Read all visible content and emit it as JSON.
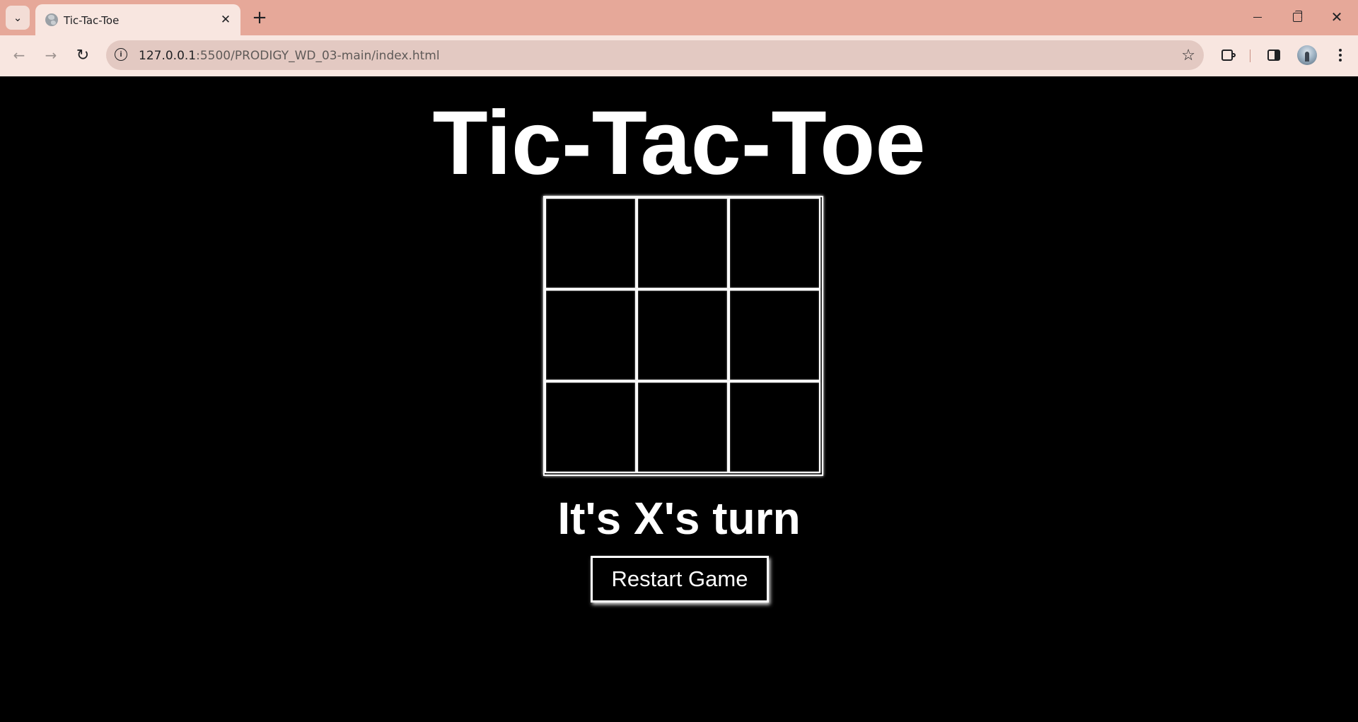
{
  "browser": {
    "tab": {
      "title": "Tic-Tac-Toe",
      "favicon": "globe-icon",
      "close_icon": "close-icon"
    },
    "new_tab_glyph": "+",
    "address": {
      "host": "127.0.0.1",
      "path": ":5500/PRODIGY_WD_03-main/index.html",
      "site_info_icon": "info-icon",
      "bookmark_icon": "star-icon"
    },
    "toolbar_icons": [
      "back-icon",
      "forward-icon",
      "reload-icon",
      "extensions-icon",
      "side-panel-icon",
      "avatar",
      "menu-icon"
    ],
    "window_controls": [
      "minimize-icon",
      "maximize-icon",
      "close-icon"
    ],
    "colors": {
      "frame": "#e6a899",
      "toolbar": "#f8e6e0",
      "omnibox": "#e3c9c2"
    }
  },
  "game": {
    "title": "Tic-Tac-Toe",
    "cells": [
      "",
      "",
      "",
      "",
      "",
      "",
      "",
      "",
      ""
    ],
    "status": "It's X's turn",
    "restart_label": "Restart Game",
    "colors": {
      "background": "#000000",
      "foreground": "#ffffff"
    }
  }
}
